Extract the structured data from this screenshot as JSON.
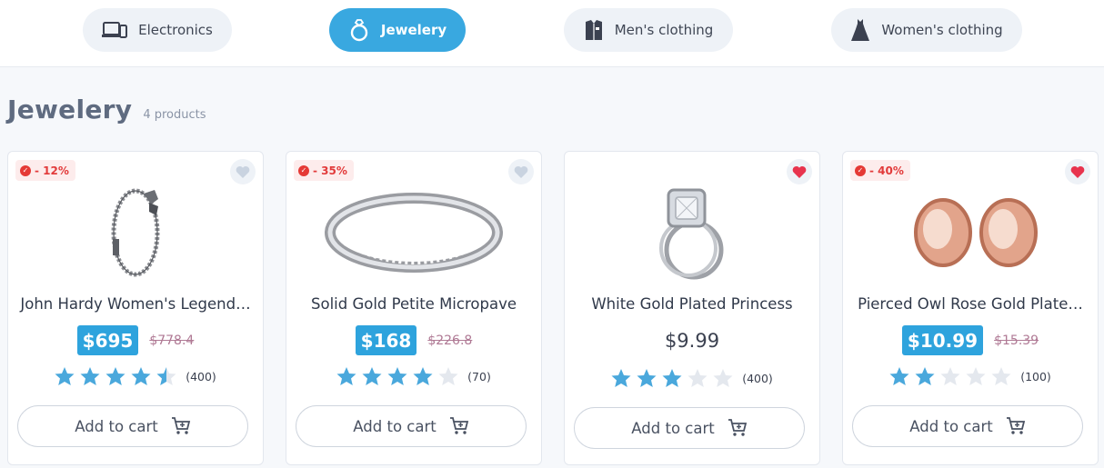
{
  "categories": [
    {
      "label": "Electronics",
      "icon": "electronics-icon",
      "active": false
    },
    {
      "label": "Jewelery",
      "icon": "ring-icon",
      "active": true
    },
    {
      "label": "Men's clothing",
      "icon": "shirt-icon",
      "active": false
    },
    {
      "label": "Women's clothing",
      "icon": "dress-icon",
      "active": false
    }
  ],
  "section": {
    "title": "Jewelery",
    "count": "4 products"
  },
  "colors": {
    "accent": "#39a8e0",
    "price_bg": "#2ea3dd",
    "star_filled": "#4aa8dc",
    "star_empty": "#e4e8ee",
    "heart_active": "#e8344e",
    "heart_inactive": "#c9d3e0",
    "discount": "#e23b3b"
  },
  "products": [
    {
      "discount": "- 12%",
      "favorite": false,
      "name": "John Hardy Women's Legend…",
      "price": "$695",
      "old_price": "$778.4",
      "rating": 4.5,
      "reviews": "(400)",
      "cart_label": "Add to cart",
      "image": "bracelet-image"
    },
    {
      "discount": "- 35%",
      "favorite": false,
      "name": "Solid Gold Petite Micropave",
      "price": "$168",
      "old_price": "$226.8",
      "rating": 4,
      "reviews": "(70)",
      "cart_label": "Add to cart",
      "image": "ring-image"
    },
    {
      "discount": "",
      "favorite": true,
      "name": "White Gold Plated Princess",
      "price": "$9.99",
      "old_price": "",
      "rating": 3,
      "reviews": "(400)",
      "cart_label": "Add to cart",
      "image": "engagement-ring-image"
    },
    {
      "discount": "- 40%",
      "favorite": true,
      "name": "Pierced Owl Rose Gold Plate…",
      "price": "$10.99",
      "old_price": "$15.39",
      "rating": 2,
      "reviews": "(100)",
      "cart_label": "Add to cart",
      "image": "tunnel-plugs-image"
    }
  ]
}
